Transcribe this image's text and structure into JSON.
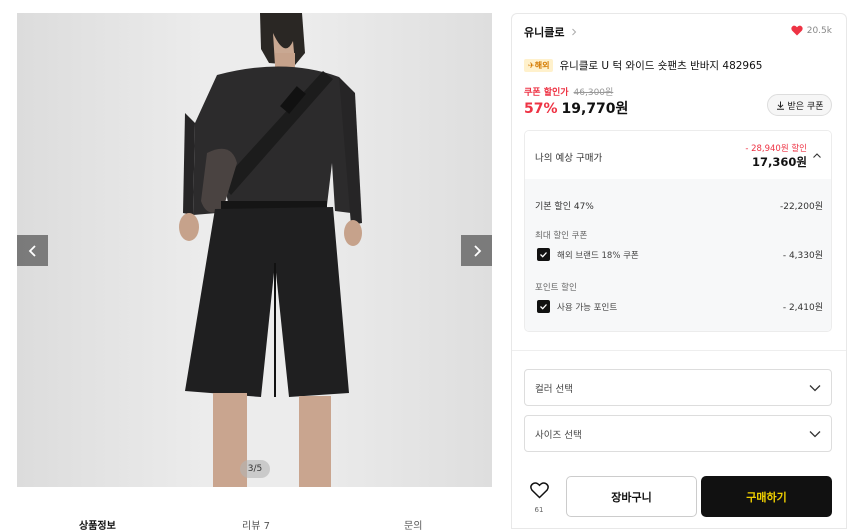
{
  "gallery": {
    "page_indicator": "3/5",
    "prev_icon": "chevron-left-icon",
    "next_icon": "chevron-right-icon"
  },
  "tabs": [
    {
      "label": "상품정보",
      "active": true
    },
    {
      "label": "리뷰 7",
      "active": false
    },
    {
      "label": "문의",
      "active": false
    }
  ],
  "product": {
    "brand": "유니클로",
    "like_count": "20.5k",
    "badge": "✈해외",
    "title": "유니클로 U 턱 와이드 숏팬츠 반바지 482965",
    "coupon_label": "쿠폰 할인가",
    "original_price": "46,300원",
    "discount_rate": "57%",
    "sale_price": "19,770원",
    "coupon_button": "받은 쿠폰"
  },
  "estimate": {
    "title": "나의 예상 구매가",
    "total_discount": "- 28,940원 할인",
    "total": "17,360원",
    "basic_label": "기본 할인 47%",
    "basic_value": "-22,200원",
    "coupon_section": "최대 할인 쿠폰",
    "coupon_item": "해외 브랜드 18% 쿠폰",
    "coupon_value": "- 4,330원",
    "point_section": "포인트 할인",
    "point_item": "사용 가능 포인트",
    "point_value": "- 2,410원"
  },
  "options": {
    "color_placeholder": "컬러 선택",
    "size_placeholder": "사이즈 선택"
  },
  "actions": {
    "wish_count": "61",
    "cart_label": "장바구니",
    "buy_label": "구매하기"
  },
  "colors": {
    "accent_red": "#ee3344",
    "buy_bg": "#111111",
    "buy_text": "#f0d000"
  }
}
